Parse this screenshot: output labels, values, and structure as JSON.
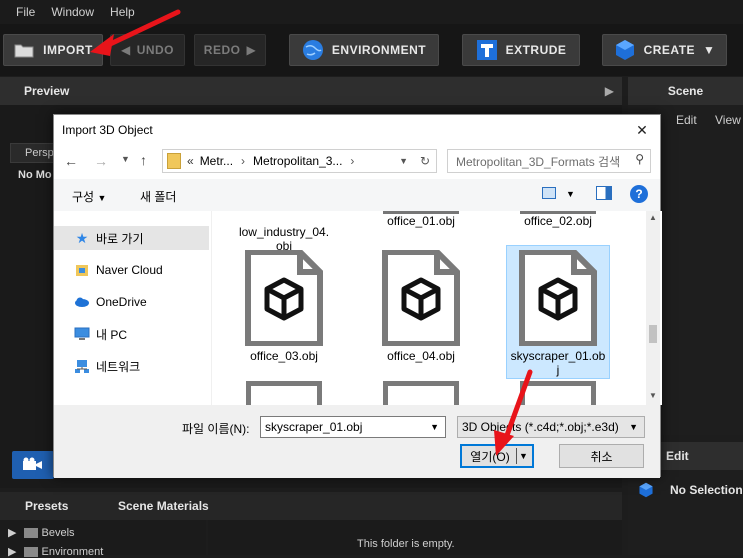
{
  "menu": [
    "File",
    "Window",
    "Help"
  ],
  "toolbar": {
    "import": "IMPORT",
    "undo": "UNDO",
    "redo": "REDO",
    "environment": "ENVIRONMENT",
    "extrude": "EXTRUDE",
    "create": "CREATE"
  },
  "panels": {
    "preview": "Preview",
    "scene": "Scene",
    "edit": "Edit",
    "view": "View",
    "persp": "Persp",
    "no_mo": "No Mo",
    "edit_panel": "Edit",
    "no_selection": "No Selection",
    "presets": "Presets",
    "scene_materials": "Scene Materials",
    "bevels": "Bevels",
    "environment_folder": "Environment",
    "empty_folder": "This folder is empty."
  },
  "dialog": {
    "title": "Import 3D Object",
    "breadcrumb": [
      "Metr...",
      "Metropolitan_3..."
    ],
    "breadcrumb_prefix": "«",
    "search_placeholder": "Metropolitan_3D_Formats 검색",
    "organize": "구성",
    "new_folder": "새 폴더",
    "sidebar": [
      {
        "label": "바로 가기",
        "icon": "star-icon"
      },
      {
        "label": "Naver Cloud",
        "icon": "cloud-folder-icon"
      },
      {
        "label": "OneDrive",
        "icon": "onedrive-cloud-icon"
      },
      {
        "label": "내 PC",
        "icon": "computer-icon"
      },
      {
        "label": "네트워크",
        "icon": "network-icon"
      }
    ],
    "files": [
      {
        "name": "low_industry_04.\nobj"
      },
      {
        "name": "office_01.obj"
      },
      {
        "name": "office_02.obj"
      },
      {
        "name": "office_03.obj"
      },
      {
        "name": "office_04.obj"
      },
      {
        "name": "skyscraper_01.ob\nj"
      }
    ],
    "filename_label": "파일 이름(N):",
    "filename_value": "skyscraper_01.obj",
    "filetype": "3D Objects (*.c4d;*.obj;*.e3d)",
    "open_button": "열기(O)",
    "cancel_button": "취소"
  },
  "colors": {
    "annotation_arrow": "#e8141a",
    "accent_blue": "#1e6fd9",
    "selection_blue": "#cce8ff"
  }
}
